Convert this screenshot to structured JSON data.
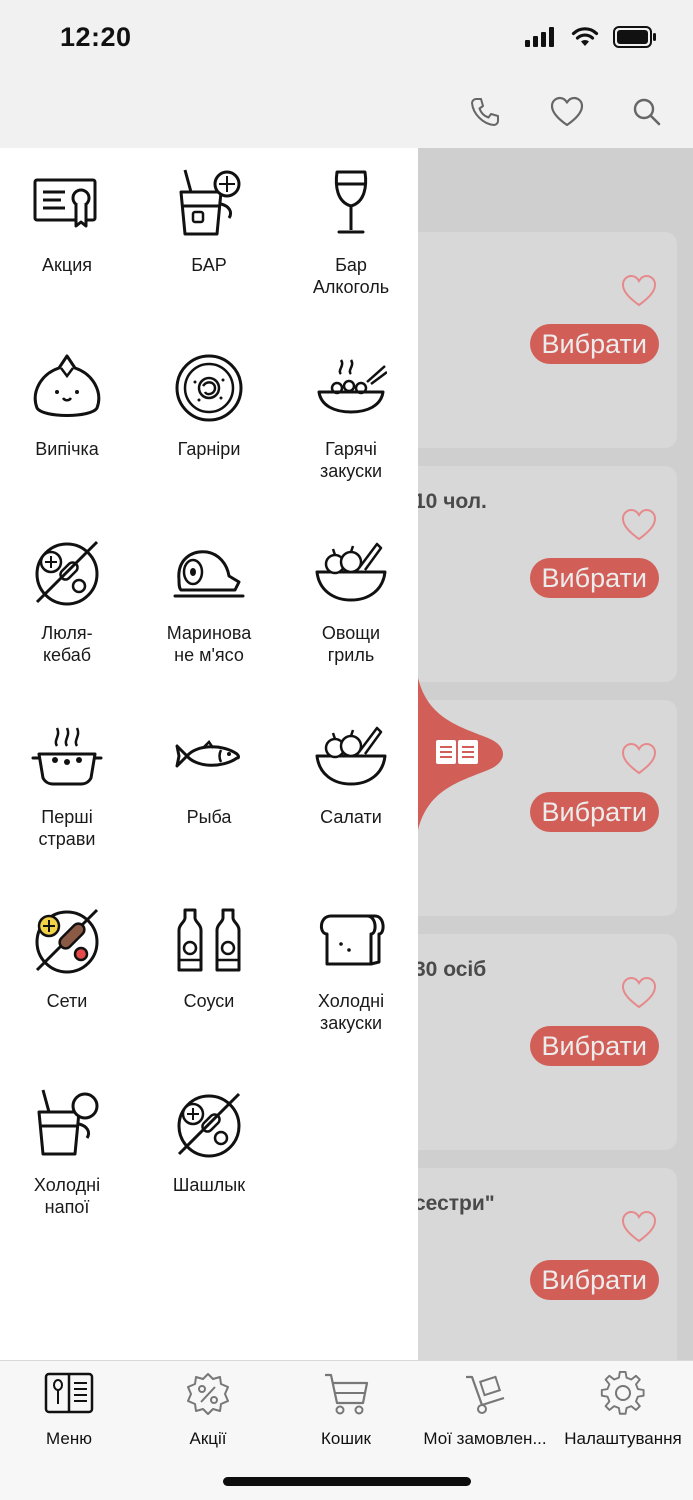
{
  "status": {
    "time": "12:20"
  },
  "header": {
    "icons": [
      "phone-icon",
      "heart-icon",
      "search-icon"
    ]
  },
  "cards": [
    {
      "title": "",
      "button": "Вибрати"
    },
    {
      "title": "10 чол.",
      "button": "Вибрати"
    },
    {
      "title": "",
      "button": "Вибрати"
    },
    {
      "title": "30 осіб",
      "button": "Вибрати"
    },
    {
      "title": "сестри\"",
      "button": "Вибрати"
    }
  ],
  "categories": [
    {
      "label": "Акция",
      "icon": "certificate-icon"
    },
    {
      "label": "БАР",
      "icon": "cocktail-icon"
    },
    {
      "label": "Бар\nАлкоголь",
      "icon": "wine-glass-icon"
    },
    {
      "label": "Випічка",
      "icon": "dumpling-icon"
    },
    {
      "label": "Гарніри",
      "icon": "plate-icon"
    },
    {
      "label": "Гарячі\nзакуски",
      "icon": "hot-bowl-icon"
    },
    {
      "label": "Люля-\nкебаб",
      "icon": "kebab-plate-icon"
    },
    {
      "label": "Маринова\nне м'ясо",
      "icon": "ham-icon"
    },
    {
      "label": "Овощи\nгриль",
      "icon": "vegetable-bowl-icon"
    },
    {
      "label": "Перші\nстрави",
      "icon": "soup-pot-icon"
    },
    {
      "label": "Рыба",
      "icon": "fish-icon"
    },
    {
      "label": "Салати",
      "icon": "salad-bowl-icon"
    },
    {
      "label": "Сети",
      "icon": "grill-set-icon"
    },
    {
      "label": "Соуси",
      "icon": "sauce-bottles-icon"
    },
    {
      "label": "Холодні\nзакуски",
      "icon": "bread-icon"
    },
    {
      "label": "Холодні\nнапої",
      "icon": "cold-drink-icon"
    },
    {
      "label": "Шашлык",
      "icon": "shashlik-plate-icon"
    }
  ],
  "tabs": [
    {
      "label": "Меню",
      "icon": "menu-book-icon"
    },
    {
      "label": "Акції",
      "icon": "discount-badge-icon"
    },
    {
      "label": "Кошик",
      "icon": "cart-icon"
    },
    {
      "label": "Мої замовлен...",
      "icon": "hand-truck-icon"
    },
    {
      "label": "Налаштування",
      "icon": "settings-gear-icon"
    }
  ],
  "colors": {
    "accent": "#d15e57",
    "drawer_bg": "#ffffff",
    "overlay_bg": "#cfcfcf"
  }
}
